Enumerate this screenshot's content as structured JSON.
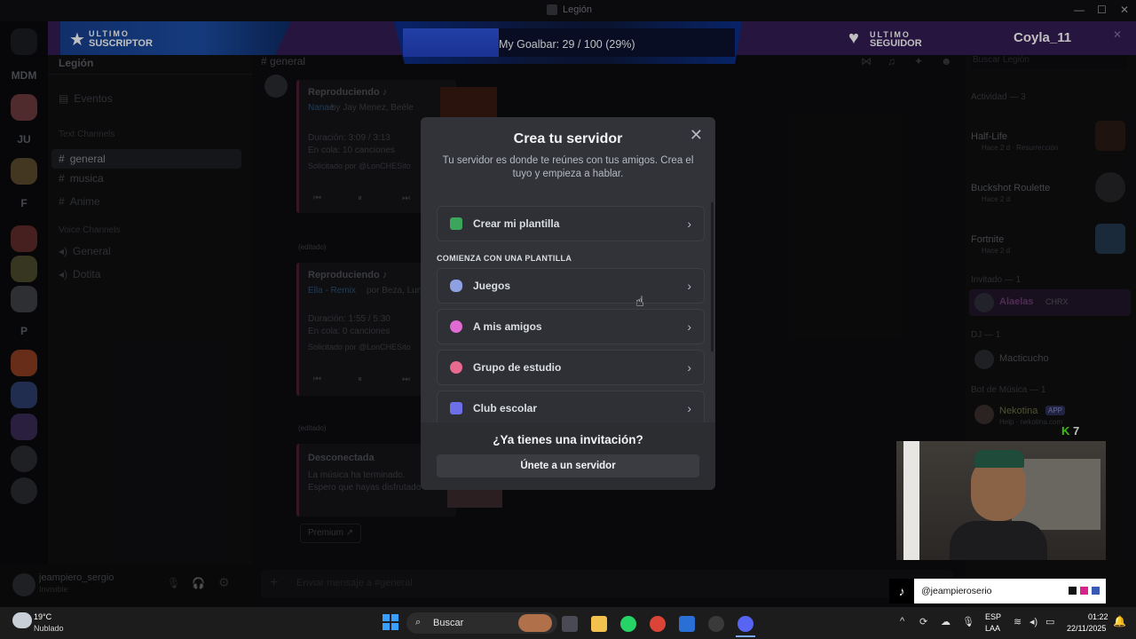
{
  "window": {
    "title": "Legión"
  },
  "rail": {
    "labels": [
      "MDM",
      "JU",
      "F",
      "P"
    ]
  },
  "server": {
    "name": "Legión",
    "channel_header": "general",
    "search_placeholder": "Buscar Legión"
  },
  "channels": {
    "events": "Eventos",
    "text_section": "Text Channels",
    "text": [
      "general",
      "musica",
      "Anime"
    ],
    "voice_section": "Voice Channels",
    "voice": [
      "General",
      "Dotita"
    ]
  },
  "chat": {
    "card1": {
      "title": "Reproduciendo ♪",
      "song": "Nanae",
      "artists": "by Jay Menez, Beéle",
      "duration": "Duración: 3:09 / 3:13",
      "queue": "En cola: 10 canciones",
      "requested": "Solicitado por @LonCHESito"
    },
    "card2": {
      "title": "Reproduciendo ♪",
      "song": "Ella - Remix",
      "artists": "por Beza, Lun",
      "duration": "Duración: 1:55 / 5:30",
      "queue": "En cola: 0 canciones",
      "requested": "Solicitado por @LonCHESito"
    },
    "card3": {
      "title": "Desconectada",
      "line1": "La música ha terminado.",
      "line2": "Espero que hayas disfrutado"
    },
    "premium": "Premium",
    "edited": "(editado)",
    "input_placeholder": "Enviar mensaje a #general"
  },
  "user": {
    "name": "jeampiero_sergio",
    "status": "Invisible"
  },
  "members": {
    "activity_header": "Actividad — 3",
    "activities": [
      {
        "game": "Half-Life",
        "sub": "Hace 2 d",
        "extra": "Resurrección"
      },
      {
        "game": "Buckshot Roulette",
        "sub": "Hace 2 d",
        "extra": ""
      },
      {
        "game": "Fortnite",
        "sub": "Hace 2 d",
        "extra": ""
      }
    ],
    "invited_header": "Invitado — 1",
    "invited_name": "Alaelas",
    "invited_tag": "CHRX",
    "dj_header": "DJ — 1",
    "dj_name": "Macticucho",
    "bot_header": "Bot de Música — 1",
    "bot_name": "Nekotina",
    "bot_badge": "APP",
    "bot_status": "Help · nekotina.com",
    "kick_count": "7"
  },
  "overlay": {
    "sub_line1": "ULTIMO",
    "sub_line2": "SUSCRIPTOR",
    "goal_text": "My Goalbar: 29 / 100 (29%)",
    "goal_fraction": 0.29,
    "follow_line1": "ULTIMO",
    "follow_line2": "SEGUIDOR",
    "follower_name": "Coyla_11",
    "tiktok_handle": "@jeampieroserio"
  },
  "modal": {
    "title": "Crea tu servidor",
    "subtitle": "Tu servidor es donde te reúnes con tus amigos. Crea el tuyo y empieza a hablar.",
    "own_option": "Crear mi plantilla",
    "section": "COMIENZA CON UNA PLANTILLA",
    "templates": [
      "Juegos",
      "A mis amigos",
      "Grupo de estudio",
      "Club escolar"
    ],
    "invite_question": "¿Ya tienes una invitación?",
    "join_button": "Únete a un servidor"
  },
  "taskbar": {
    "weather_temp": "19°C",
    "weather_desc": "Nublado",
    "search_label": "Buscar",
    "lang": "ESP",
    "lang2": "LAA",
    "time": "01:22",
    "date": "22/11/2025"
  }
}
